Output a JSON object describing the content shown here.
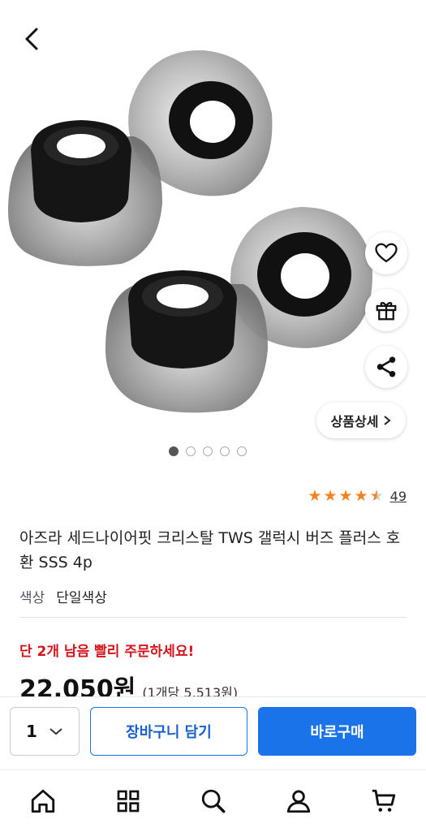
{
  "header": {
    "back_icon": "chevron-left-icon"
  },
  "product": {
    "image_alt": "earbud-tips-photo",
    "detail_label": "상품상세",
    "carousel_pages": 5,
    "carousel_active": 1,
    "rating_value": 4.5,
    "review_count": "49",
    "title": "아즈라 세드나이어핏 크리스탈 TWS 갤럭시 버즈 플러스 호환 SSS 4p",
    "option_label": "색상",
    "option_value": "단일색상",
    "urgency": "단 2개 남음 빨리 주문하세요!",
    "price": "22,050원",
    "unit_price": "(1개당 5,513원)"
  },
  "buybar": {
    "quantity": "1",
    "cart_label": "장바구니 담기",
    "buy_label": "바로구매"
  },
  "colors": {
    "accent": "#1a73e8",
    "urgent": "#d4141b",
    "star": "#f5841f"
  },
  "nav": [
    "home-icon",
    "category-icon",
    "search-icon",
    "user-icon",
    "cart-icon"
  ]
}
